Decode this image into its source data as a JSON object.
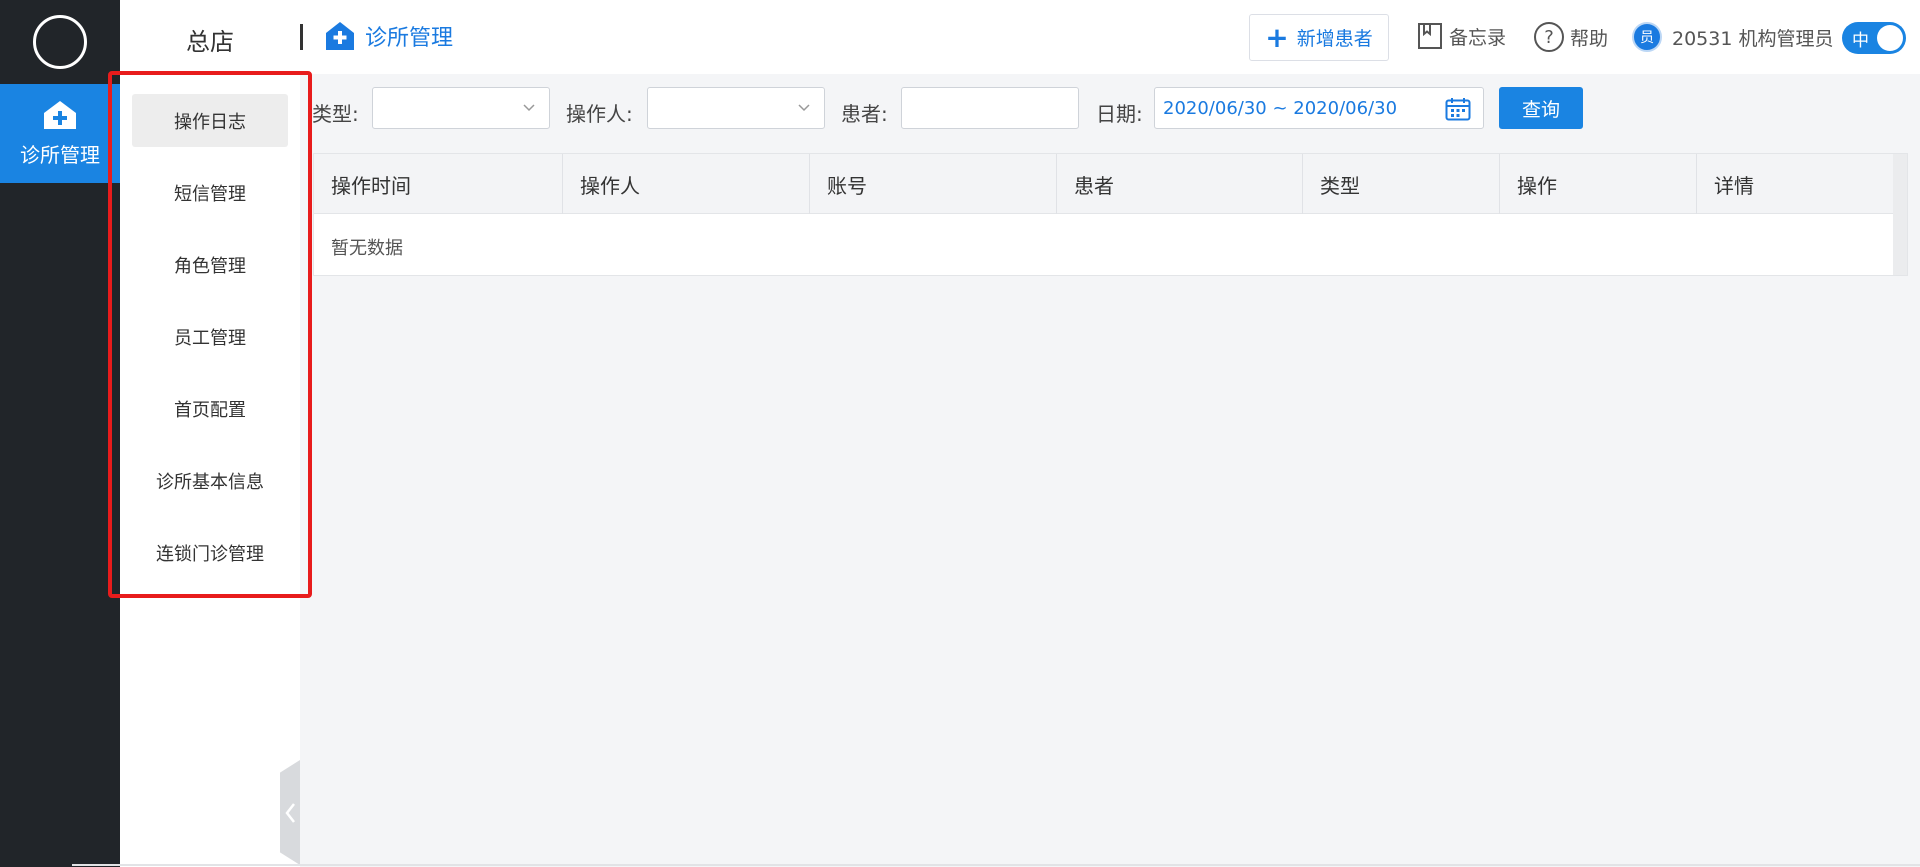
{
  "rail": {
    "module_label": "诊所管理"
  },
  "submenu": {
    "items": [
      {
        "label": "操作日志",
        "active": true
      },
      {
        "label": "短信管理",
        "active": false
      },
      {
        "label": "角色管理",
        "active": false
      },
      {
        "label": "员工管理",
        "active": false
      },
      {
        "label": "首页配置",
        "active": false
      },
      {
        "label": "诊所基本信息",
        "active": false
      },
      {
        "label": "连锁门诊管理",
        "active": false
      }
    ]
  },
  "header": {
    "store_name": "总店",
    "breadcrumb": "诊所管理",
    "new_patient_label": "新增患者",
    "memo_label": "备忘录",
    "help_label": "帮助",
    "avatar_text": "员",
    "user_label": "20531 机构管理员",
    "lang_toggle_label": "中"
  },
  "filters": {
    "type_label": "类型:",
    "operator_label": "操作人:",
    "patient_label": "患者:",
    "date_label": "日期:",
    "date_range": "2020/06/30 ~ 2020/06/30",
    "query_label": "查询"
  },
  "table": {
    "columns": [
      "操作时间",
      "操作人",
      "账号",
      "患者",
      "类型",
      "操作",
      "详情"
    ],
    "empty_text": "暂无数据"
  },
  "colors": {
    "accent": "#1a84e2",
    "rail_bg": "#212529",
    "highlight": "#e81c1c"
  }
}
